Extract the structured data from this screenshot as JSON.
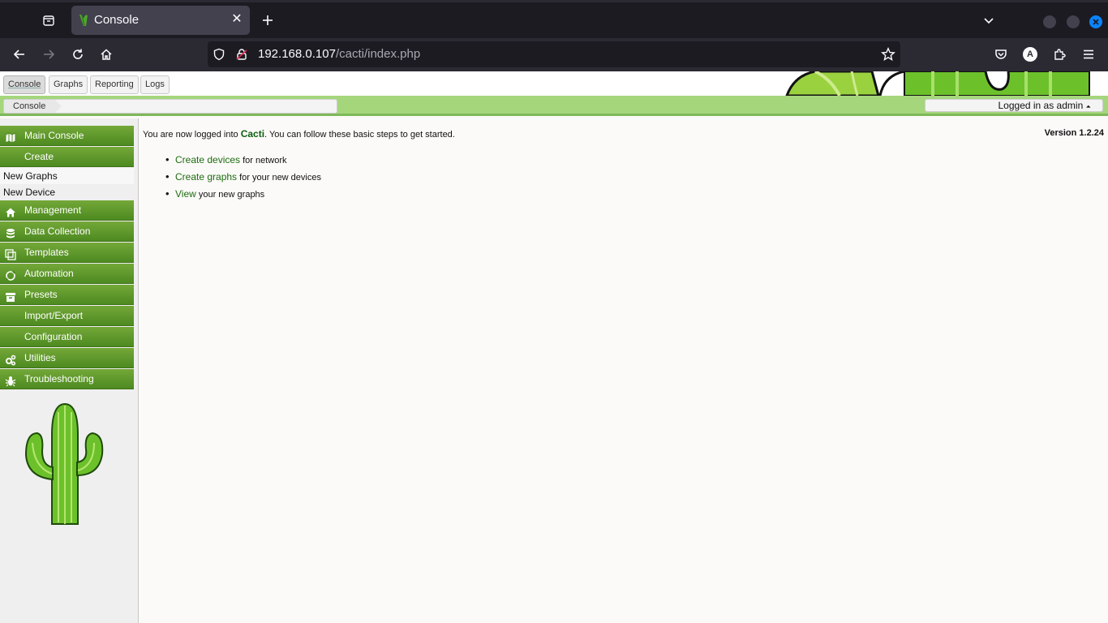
{
  "browser": {
    "tab_title": "Console",
    "url_host": "192.168.0.107",
    "url_path": "/cacti/index.php",
    "account_initial": "A",
    "close_tab_glyph": "✕",
    "new_tab_glyph": "+",
    "icons": [
      "list-all-tabs-icon",
      "new-tab-icon",
      "tabs-dropdown-icon",
      "back-icon",
      "forward-icon",
      "reload-icon",
      "home-icon",
      "shield-icon",
      "lock-icon",
      "star-icon",
      "pocket-icon",
      "account-icon",
      "extensions-icon",
      "menu-icon"
    ]
  },
  "cacti": {
    "tabs": [
      {
        "label": "Console",
        "selected": true
      },
      {
        "label": "Graphs"
      },
      {
        "label": "Reporting"
      },
      {
        "label": "Logs"
      }
    ],
    "breadcrumb": "Console",
    "user_status": "Logged in as admin",
    "user_caret": "⏶",
    "menu": {
      "main_console": "Main Console",
      "create": "Create",
      "new_graphs": "New Graphs",
      "new_device": "New Device",
      "management": "Management",
      "data_collection": "Data Collection",
      "templates": "Templates",
      "automation": "Automation",
      "presets": "Presets",
      "import_export": "Import/Export",
      "configuration": "Configuration",
      "utilities": "Utilities",
      "troubleshooting": "Troubleshooting"
    },
    "intro_prefix": "You are now logged into ",
    "intro_brand": "Cacti",
    "intro_suffix": ". You can follow these basic steps to get started.",
    "version": "Version 1.2.24",
    "steps": [
      {
        "link": "Create devices",
        "text": " for network"
      },
      {
        "link": "Create graphs",
        "text": " for your new devices"
      },
      {
        "link": "View",
        "text": " your new graphs"
      }
    ],
    "colors": {
      "menu_green": "#5d9a2b",
      "breadcrumb_bar": "#a5d67c",
      "link_green": "#1d6d11",
      "accent_blue": "#0a84ff"
    }
  }
}
